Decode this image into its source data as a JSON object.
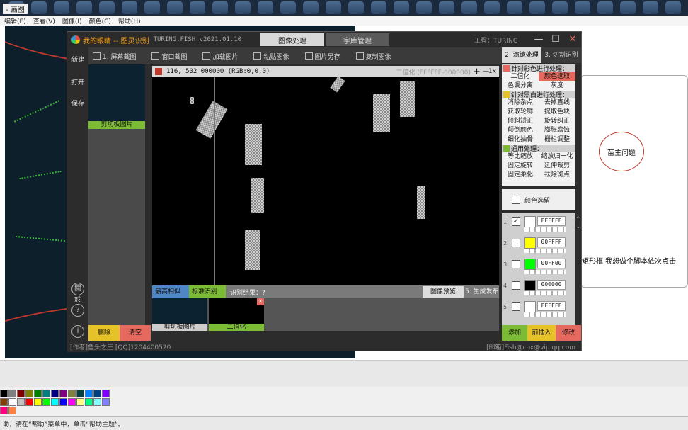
{
  "paint": {
    "window_title": "- 画图",
    "menu": [
      "编辑(E)",
      "查看(V)",
      "图像(I)",
      "颜色(C)",
      "帮助(H)"
    ],
    "status": "助，请在“帮助”菜单中，单击“帮助主题”。",
    "annotation_circle": "苗主问题",
    "bubble_text": "矩形框 我想做个脚本依次点击"
  },
  "palette": [
    "#000000",
    "#808080",
    "#800000",
    "#808000",
    "#008000",
    "#008080",
    "#000080",
    "#800080",
    "#808040",
    "#004040",
    "#0080ff",
    "#004080",
    "#8000ff",
    "#804000",
    "#ffffff",
    "#c0c0c0",
    "#ff0000",
    "#ffff00",
    "#00ff00",
    "#00ffff",
    "#0000ff",
    "#ff00ff",
    "#ffff80",
    "#00ff80",
    "#80ffff",
    "#8080ff",
    "#ff0080",
    "#ff8040"
  ],
  "app": {
    "brand": "我的眼睛 -- 图灵识别",
    "version": "TURING.FISH v2021.01.10",
    "tabs": {
      "image": "图像处理",
      "library": "字库管理"
    },
    "project": "工程：TURING",
    "win_controls": {
      "min": "—",
      "max": "☐",
      "close": "✕"
    },
    "left": {
      "new": "新建",
      "open": "打开",
      "save": "保存",
      "about": "關於",
      "help": "?",
      "info": "i"
    },
    "toolbar": [
      "1. 屏幕截图",
      "窗口截图",
      "加载图片",
      "粘贴图像",
      "图片另存",
      "复制图像"
    ],
    "clip_label": "剪切板图片",
    "delete": "删除",
    "clear": "清空",
    "info": {
      "coord": "116, 502  000000 (RGB:0,0,0)",
      "mode": "二值化 (FFFFFF-000000)",
      "zoom": "1x",
      "plus": "+",
      "minus": "—"
    },
    "bottom": {
      "similar": "最高相似",
      "standard": "标准识别",
      "result": "识别结果：?",
      "preview": "图像预览",
      "generate": "5. 生成发布"
    },
    "thumbs": {
      "clip": "剪切板图片",
      "binary": "二值化",
      "close": "✕"
    },
    "footer": {
      "author": "[作者]鱼头之王  [QQ]1204400520",
      "email": "[邮箱]Fish@cox@vip.qq.com"
    },
    "right_tabs": {
      "filter": "2. 滤镜处理",
      "cut": "3. 切割识别"
    },
    "color_section": {
      "title": "针对彩色进行处理：",
      "color": "#e5695e",
      "items": [
        "二值化",
        "颜色选取",
        "色调分离",
        "灰度"
      ]
    },
    "bw_section": {
      "title": "针对黑白进行处理：",
      "color": "#e6c229",
      "items": [
        "消除杂点",
        "去掉直线",
        "获取轮廓",
        "提取色块",
        "倾斜矫正",
        "旋转纠正",
        "颠倒颜色",
        "膨胀腐蚀",
        "细化抽骨",
        "栅栏调整"
      ]
    },
    "general_section": {
      "title": "通用处理：",
      "color": "#7cbb36",
      "items": [
        "等比缩放",
        "缩放归一化",
        "固定旋转",
        "延伸裁剪",
        "固定柔化",
        "祛除斑点"
      ]
    },
    "color_keep": "颜色选留",
    "color_rows": [
      {
        "idx": "1",
        "checked": "✓",
        "color": "#ffffff",
        "hex": "FFFFFF"
      },
      {
        "idx": "2",
        "checked": "",
        "color": "#ffff00",
        "hex": "00FFFF"
      },
      {
        "idx": "3",
        "checked": "",
        "color": "#00ff00",
        "hex": "00FF00"
      },
      {
        "idx": "4",
        "checked": "",
        "color": "#000000",
        "hex": "000000"
      },
      {
        "idx": "5",
        "checked": "",
        "color": "#ffffff",
        "hex": "FFFFFF"
      }
    ],
    "actions": {
      "add": "添加",
      "insert": "前插入",
      "modify": "修改"
    }
  }
}
